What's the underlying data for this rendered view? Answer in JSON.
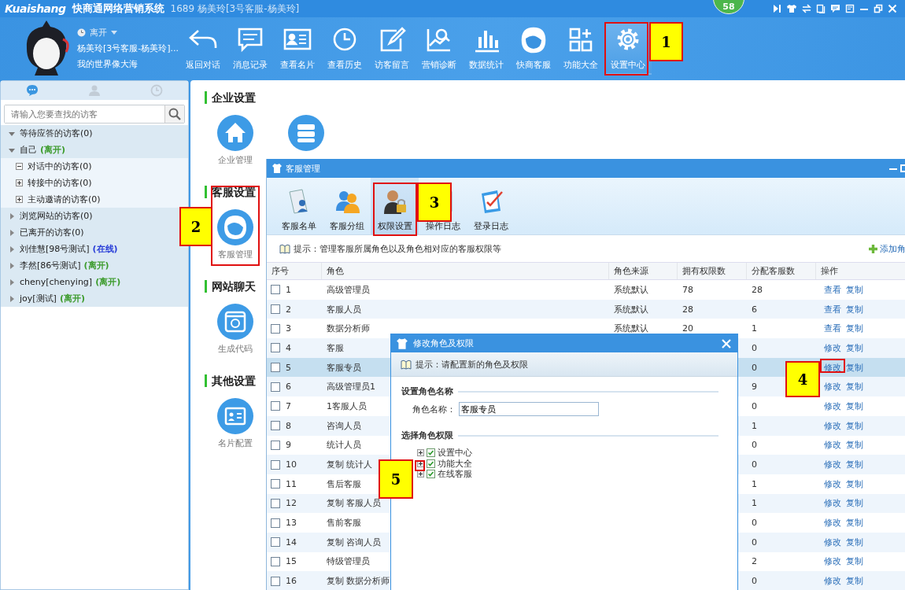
{
  "title_bar": {
    "logo": "Kuaishang",
    "app_name": "快商通网络营销系统",
    "user": "1689 杨美玲[3号客服-杨美玲]",
    "badge": "58"
  },
  "profile": {
    "status": "离开",
    "name": "杨美玲[3号客服-杨美玲]...",
    "motto": "我的世界像大海"
  },
  "toolbar": [
    {
      "label": "返回对话",
      "kind": "back",
      "selected": false
    },
    {
      "label": "消息记录",
      "kind": "messages",
      "selected": false
    },
    {
      "label": "查看名片",
      "kind": "card",
      "selected": false
    },
    {
      "label": "查看历史",
      "kind": "history",
      "selected": false
    },
    {
      "label": "访客留言",
      "kind": "note",
      "selected": false
    },
    {
      "label": "营销诊断",
      "kind": "diagnose",
      "selected": false
    },
    {
      "label": "数据统计",
      "kind": "stats",
      "selected": false
    },
    {
      "label": "快商客服",
      "kind": "service",
      "selected": false
    },
    {
      "label": "功能大全",
      "kind": "apps",
      "selected": false
    },
    {
      "label": "设置中心",
      "kind": "settings",
      "selected": true
    }
  ],
  "sidebar": {
    "tabs": [
      {
        "kind": "chat",
        "selected": true
      },
      {
        "kind": "contacts",
        "selected": false
      },
      {
        "kind": "history",
        "selected": false
      }
    ],
    "search": {
      "placeholder": "请输入您要查找的访客"
    },
    "tree": [
      {
        "label": "等待应答的访客(0)",
        "expanded": true
      },
      {
        "label": "自己",
        "status": "(离开)",
        "color": "#3c9b2c",
        "expanded": true,
        "children": [
          {
            "label": "对话中的访客(0)",
            "expanded": true
          },
          {
            "label": "转接中的访客(0)",
            "expanded": false
          },
          {
            "label": "主动邀请的访客(0)",
            "expanded": false
          }
        ]
      },
      {
        "label": "浏览网站的访客(0)",
        "expanded": false
      },
      {
        "label": "已离开的访客(0)",
        "expanded": false
      },
      {
        "label": "刘佳慧[98号测试]",
        "status": "(在线)",
        "color": "#2a3fd8",
        "expanded": false
      },
      {
        "label": "李然[86号测试]",
        "status": "(离开)",
        "color": "#3c9b2c",
        "expanded": false
      },
      {
        "label": "cheny[chenying]",
        "status": "(离开)",
        "color": "#3c9b2c",
        "expanded": false
      },
      {
        "label": "joy[测试]",
        "status": "(离开)",
        "color": "#3c9b2c",
        "expanded": false
      }
    ]
  },
  "settings": [
    {
      "title": "企业设置",
      "items": [
        {
          "label": "企业管理",
          "kind": "home"
        },
        {
          "kind": "server"
        }
      ]
    },
    {
      "title": "客服设置",
      "items": [
        {
          "label": "客服管理",
          "kind": "service"
        }
      ]
    },
    {
      "title": "网站聊天",
      "items": [
        {
          "label": "生成代码",
          "kind": "code"
        }
      ]
    },
    {
      "title": "其他设置",
      "items": [
        {
          "label": "名片配置",
          "kind": "card"
        }
      ]
    }
  ],
  "window": {
    "title": "客服管理",
    "tools": [
      {
        "label": "客服名单",
        "kind": "list",
        "selected": false
      },
      {
        "label": "客服分组",
        "kind": "group",
        "selected": false
      },
      {
        "label": "权限设置",
        "kind": "lock",
        "selected": true
      },
      {
        "label": "操作日志",
        "kind": "log",
        "selected": false
      },
      {
        "label": "登录日志",
        "kind": "login",
        "selected": false
      }
    ],
    "hint": "提示：管理客服所属角色以及角色相对应的客服权限等",
    "add_button": "添加角",
    "table": {
      "columns": [
        "序号",
        "角色",
        "角色来源",
        "拥有权限数",
        "分配客服数",
        "操作"
      ],
      "rows": [
        {
          "no": "1",
          "role": "高级管理员",
          "source": "系统默认",
          "permissions": "78",
          "assigned": "28",
          "actions": [
            "查看",
            "复制"
          ],
          "selected": false
        },
        {
          "no": "2",
          "role": "客服人员",
          "source": "系统默认",
          "permissions": "28",
          "assigned": "6",
          "actions": [
            "查看",
            "复制"
          ],
          "selected": false
        },
        {
          "no": "3",
          "role": "数据分析师",
          "source": "系统默认",
          "permissions": "20",
          "assigned": "1",
          "actions": [
            "查看",
            "复制"
          ],
          "selected": false
        },
        {
          "no": "4",
          "role": "客服",
          "assigned": "0",
          "actions": [
            "修改",
            "复制"
          ],
          "selected": false
        },
        {
          "no": "5",
          "role": "客服专员",
          "assigned": "0",
          "actions": [
            "修改",
            "复制"
          ],
          "selected": true
        },
        {
          "no": "6",
          "role": "高级管理员1",
          "assigned": "9",
          "actions": [
            "修改",
            "复制"
          ],
          "selected": false
        },
        {
          "no": "7",
          "role": "1客服人员",
          "assigned": "0",
          "actions": [
            "修改",
            "复制"
          ],
          "selected": false
        },
        {
          "no": "8",
          "role": "咨询人员",
          "assigned": "1",
          "actions": [
            "修改",
            "复制"
          ],
          "selected": false
        },
        {
          "no": "9",
          "role": "统计人员",
          "assigned": "0",
          "actions": [
            "修改",
            "复制"
          ],
          "selected": false
        },
        {
          "no": "10",
          "role": "复制 统计人",
          "assigned": "0",
          "actions": [
            "修改",
            "复制"
          ],
          "selected": false
        },
        {
          "no": "11",
          "role": "售后客服",
          "assigned": "1",
          "actions": [
            "修改",
            "复制"
          ],
          "selected": false
        },
        {
          "no": "12",
          "role": "复制 客服人员",
          "assigned": "1",
          "actions": [
            "修改",
            "复制"
          ],
          "selected": false
        },
        {
          "no": "13",
          "role": "售前客服",
          "assigned": "0",
          "actions": [
            "修改",
            "复制"
          ],
          "selected": false
        },
        {
          "no": "14",
          "role": "复制 咨询人员",
          "assigned": "0",
          "actions": [
            "修改",
            "复制"
          ],
          "selected": false
        },
        {
          "no": "15",
          "role": "特级管理员",
          "assigned": "2",
          "actions": [
            "修改",
            "复制"
          ],
          "selected": false
        },
        {
          "no": "16",
          "role": "复制 数据分析师",
          "assigned": "0",
          "actions": [
            "修改",
            "复制"
          ],
          "selected": false
        }
      ]
    }
  },
  "dialog": {
    "title": "修改角色及权限",
    "hint": "提示：请配置新的角色及权限",
    "name_section": "设置角色名称",
    "name_label": "角色名称：",
    "name_value": "客服专员",
    "permission_section": "选择角色权限",
    "permissions": [
      {
        "label": "设置中心",
        "checked": true,
        "expanded": false
      },
      {
        "label": "功能大全",
        "checked": true,
        "expanded": false
      },
      {
        "label": "在线客服",
        "checked": true,
        "expanded": false
      }
    ]
  },
  "callouts": [
    {
      "number": "1"
    },
    {
      "number": "2"
    },
    {
      "number": "3"
    },
    {
      "number": "4"
    },
    {
      "number": "5"
    }
  ]
}
